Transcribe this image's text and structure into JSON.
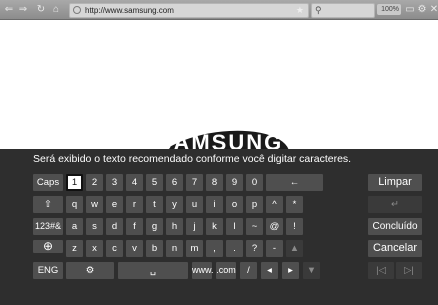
{
  "toolbar": {
    "back": "⇐",
    "forward": "⇒",
    "reload": "↻",
    "home": "⌂",
    "url": "http://www.samsung.com",
    "zoom": "100%"
  },
  "page": {
    "logo_text": "SAMSUNG"
  },
  "keyboard": {
    "prompt": "Será exibido o texto recomendado conforme você digitar caracteres.",
    "row1": [
      "Caps",
      "1",
      "2",
      "3",
      "4",
      "5",
      "6",
      "7",
      "8",
      "9",
      "0",
      "←"
    ],
    "row2": [
      "⇧",
      "q",
      "w",
      "e",
      "r",
      "t",
      "y",
      "u",
      "i",
      "o",
      "p",
      "^",
      "*"
    ],
    "row3": [
      "123#&",
      "a",
      "s",
      "d",
      "f",
      "g",
      "h",
      "j",
      "k",
      "l",
      "~",
      "@",
      "!"
    ],
    "row4": [
      "z",
      "x",
      "c",
      "v",
      "b",
      "n",
      "m",
      ",",
      ".",
      "?",
      "-"
    ],
    "row5": [
      "ENG",
      "⚙",
      "␣",
      "www.",
      ".com",
      "/",
      "◂",
      "▸"
    ],
    "actions": {
      "clear": "Limpar",
      "done": "Concluído",
      "cancel": "Cancelar"
    },
    "globe": "⊕",
    "disabled_enter": "↵",
    "disabled_up": "▲",
    "disabled_down": "▼",
    "disabled_prev": "|◁",
    "disabled_next": "▷|"
  }
}
